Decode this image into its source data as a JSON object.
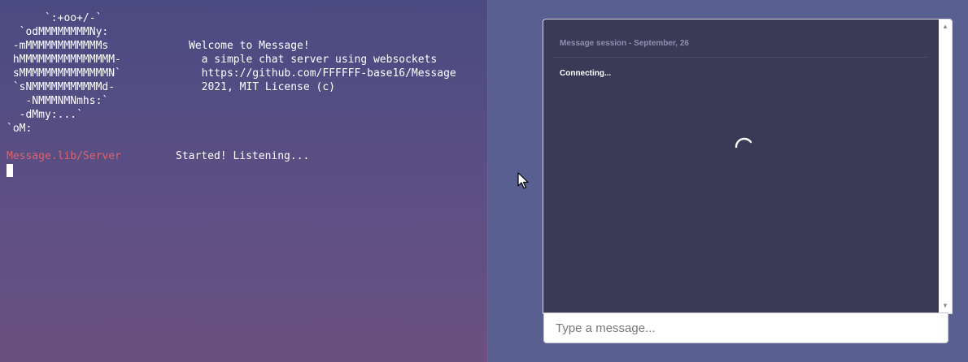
{
  "terminal": {
    "logo_lines": [
      "      `:+oo+/-`",
      "  `odMMMMMMMMNy:",
      " -mMMMMMMMMMMMMs",
      " hMMMMMMMMMMMMMMM-",
      " sMMMMMMMMMMMMMMN`",
      " `sNMMMMMMMMMMMd-",
      "   -NMMMNMNmhs:`",
      "  -dMmy:...`",
      "`oM:"
    ],
    "welcome_lines": [
      "Welcome to Message!",
      "  a simple chat server using websockets",
      "  https://github.com/FFFFFF-base16/Message",
      "  2021, MIT License (c)"
    ],
    "log": {
      "module": "Message.lib/Server",
      "message": "Started! Listening..."
    }
  },
  "chat": {
    "session_header": "Message session - September, 26",
    "status": "Connecting...",
    "input_placeholder": "Type a message..."
  },
  "colors": {
    "module_red": "#e0606e",
    "chat_bg": "#3b3a56",
    "divider_blue": "#2f78c8"
  }
}
